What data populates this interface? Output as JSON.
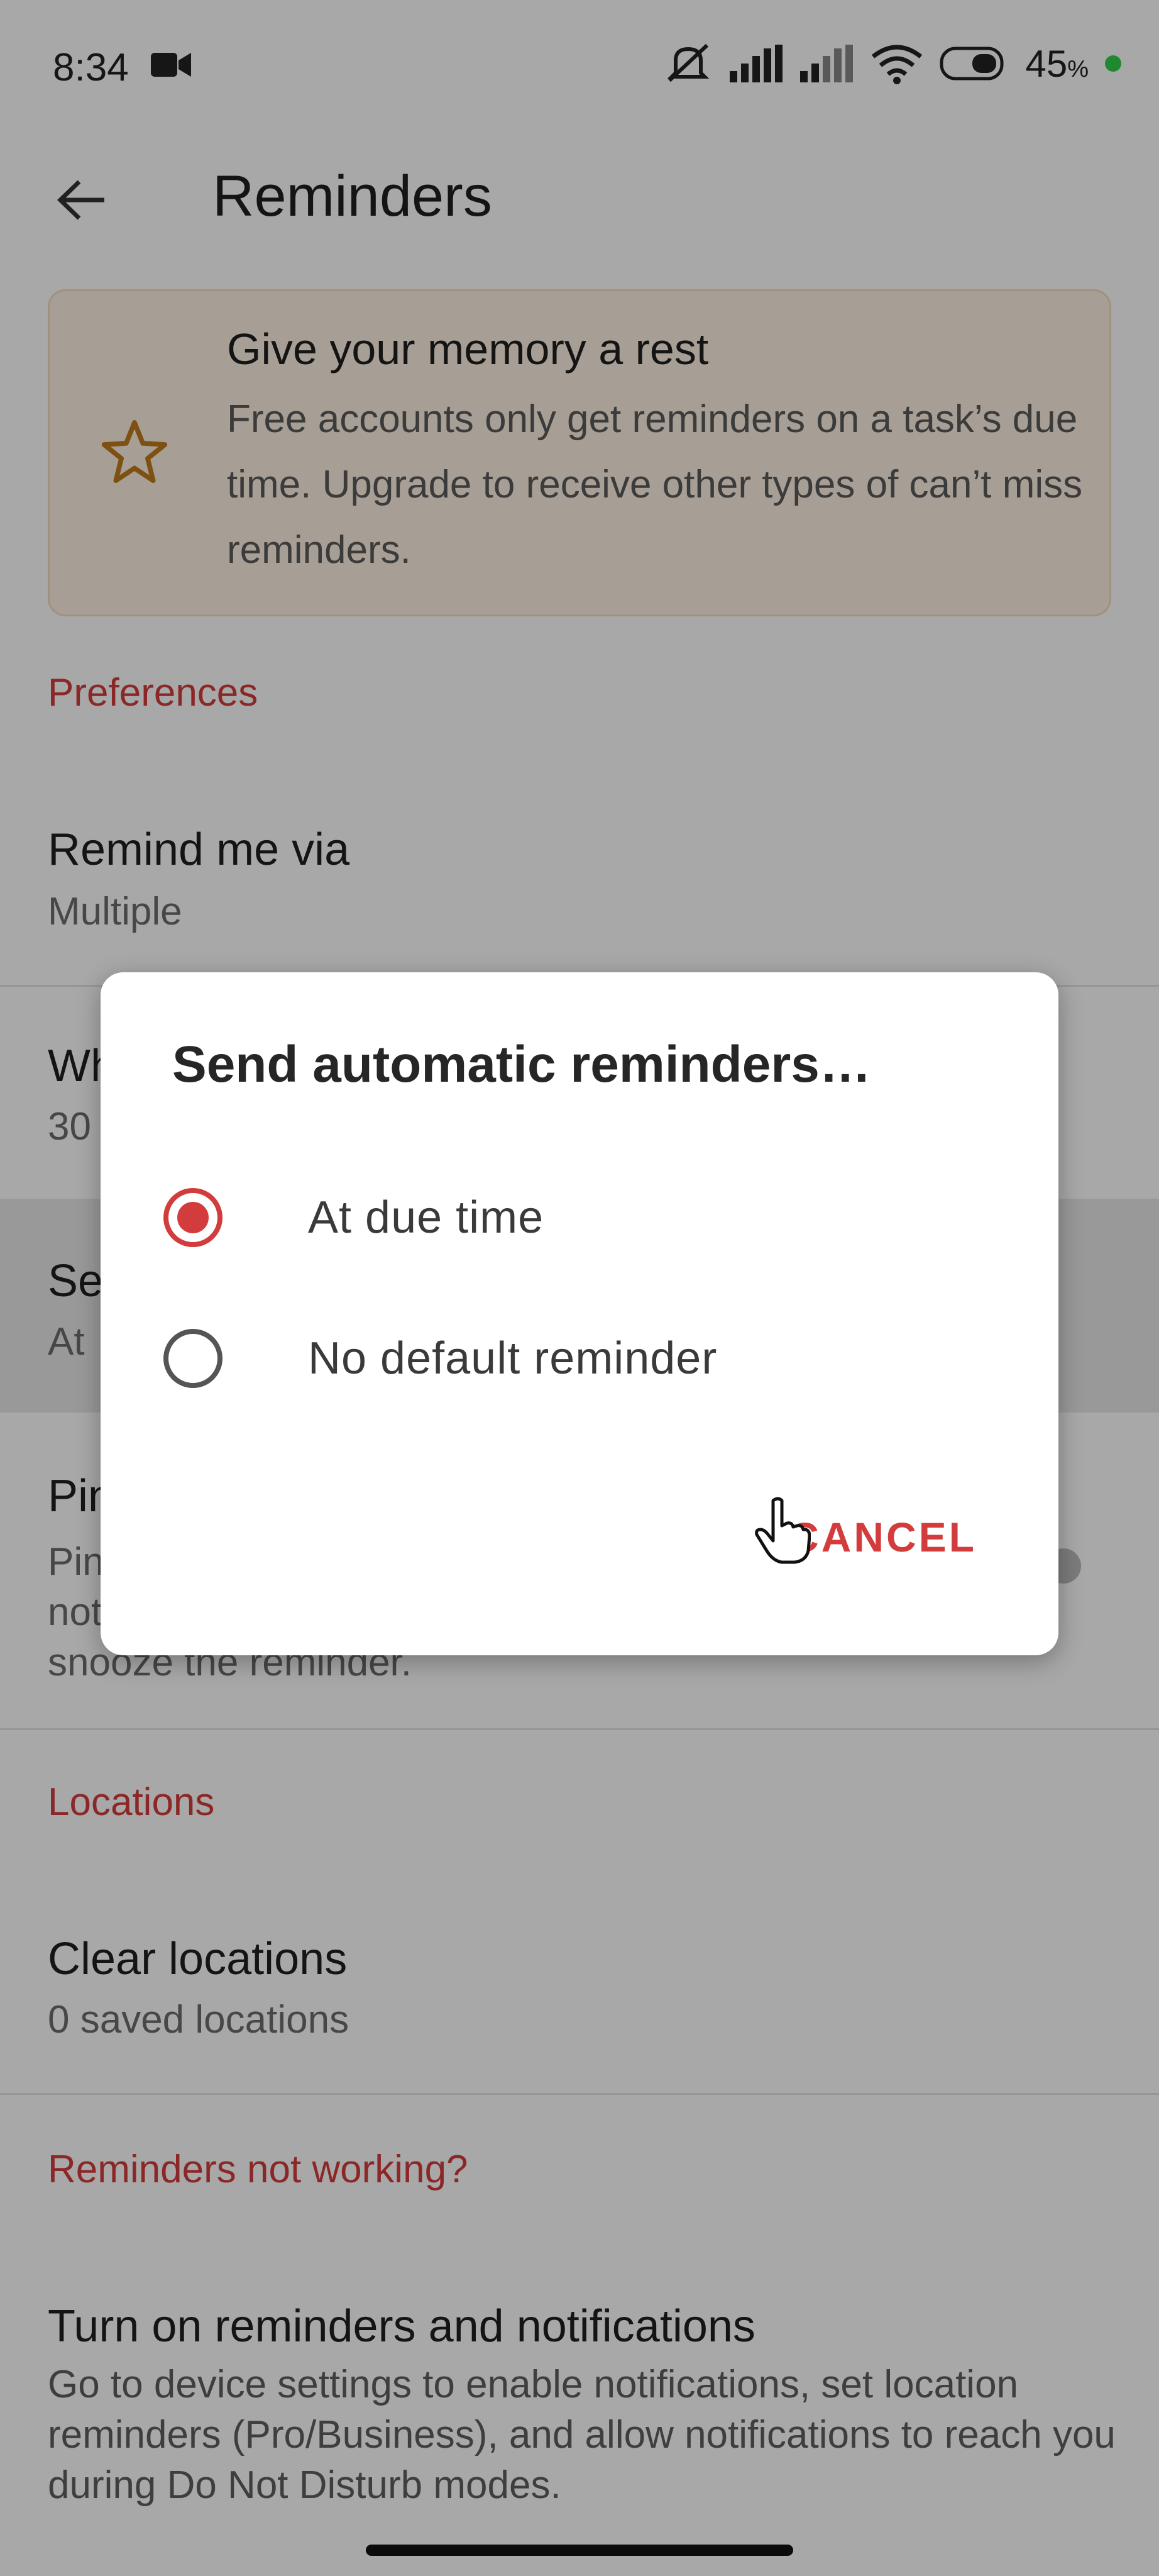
{
  "status_bar": {
    "time": "8:34",
    "battery": "45",
    "battery_unit": "%"
  },
  "app_bar": {
    "title": "Reminders"
  },
  "promo": {
    "title": "Give your memory a rest",
    "body": "Free accounts only get reminders on a task’s due time. Upgrade to receive other types of can’t miss reminders."
  },
  "preferences": {
    "header": "Preferences",
    "remind_via": {
      "title": "Remind me via",
      "value": "Multiple"
    },
    "when": {
      "title_partial": "Wh",
      "value_partial": "30"
    },
    "send_auto": {
      "title_partial": "Se",
      "value_partial": "At"
    },
    "pin": {
      "title_partial": "Pin",
      "body_partial": "Pin\nnot\nsnooze the reminder."
    }
  },
  "locations": {
    "header": "Locations",
    "clear": {
      "title": "Clear locations",
      "value": "0 saved locations"
    }
  },
  "troubleshoot": {
    "header": "Reminders not working?",
    "notifications": {
      "title": "Turn on reminders and notifications",
      "body": "Go to device settings to enable notifications, set location reminders (Pro/Business), and allow notifications to reach you during Do Not Disturb modes."
    }
  },
  "dialog": {
    "title": "Send automatic reminders…",
    "options": [
      {
        "label": "At due time",
        "selected": true
      },
      {
        "label": "No default reminder",
        "selected": false
      }
    ],
    "cancel_label": "CANCEL"
  },
  "colors": {
    "accent": "#d33c3c",
    "promo_bg": "#fdf1e2",
    "star": "#c07a1a",
    "battery_dot": "#2fd04a"
  },
  "icons": {
    "back": "arrow-left-icon",
    "promo": "star-icon",
    "status": [
      "video-icon",
      "mute-icon",
      "signal-icon",
      "wifi-icon",
      "battery-icon"
    ]
  }
}
